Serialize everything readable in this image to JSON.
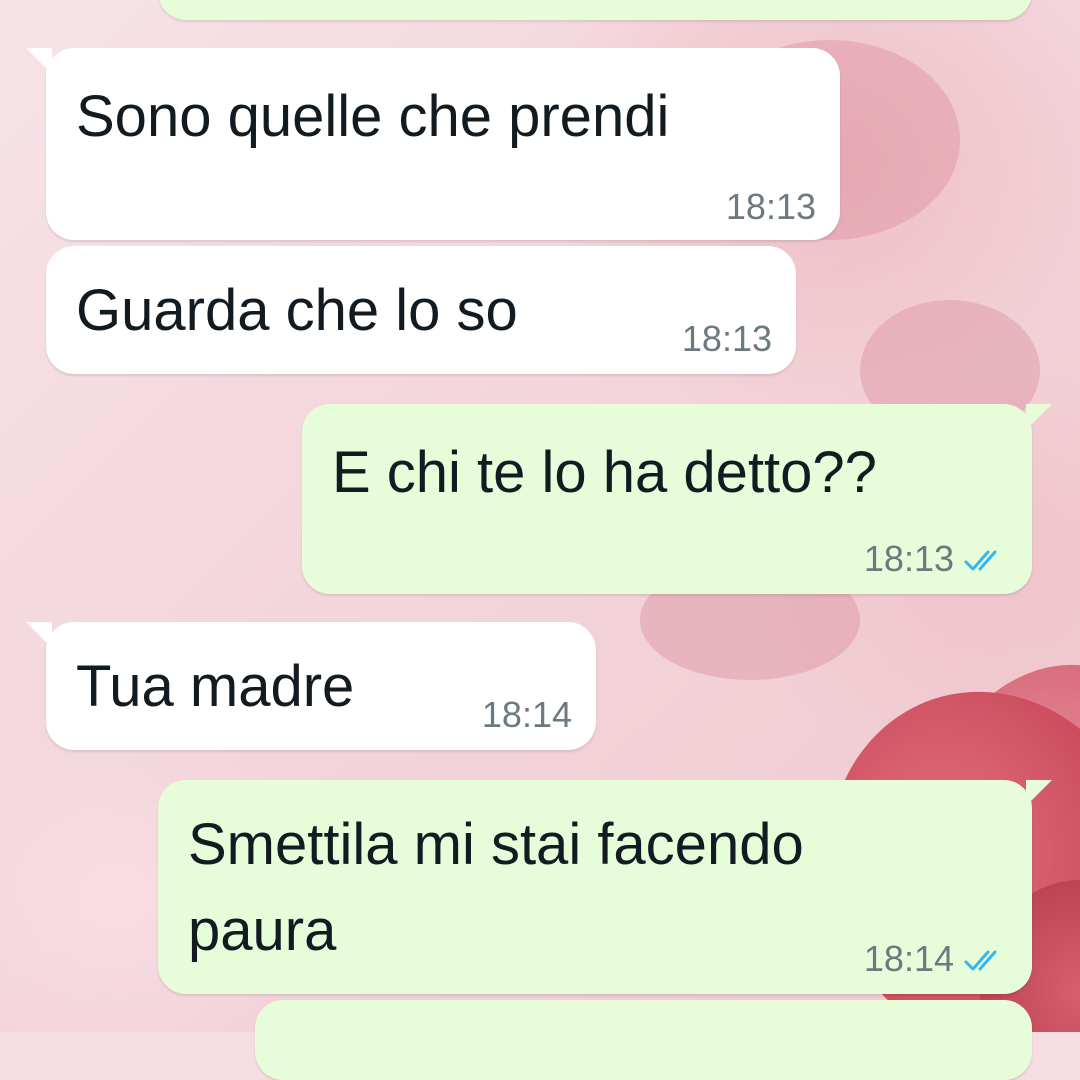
{
  "colors": {
    "incoming_bubble": "#ffffff",
    "outgoing_bubble": "#e7fcd9",
    "read_ticks": "#34b7f1",
    "timestamp": "#6b7a80"
  },
  "messages": [
    {
      "direction": "outgoing",
      "text": "",
      "time": ""
    },
    {
      "direction": "incoming",
      "text": "Sono quelle che prendi",
      "time": "18:13"
    },
    {
      "direction": "incoming",
      "text": "Guarda che lo so",
      "time": "18:13"
    },
    {
      "direction": "outgoing",
      "text": "E chi te lo ha detto??",
      "time": "18:13",
      "status_icon": "double-check-read-icon"
    },
    {
      "direction": "incoming",
      "text": "Tua madre",
      "time": "18:14"
    },
    {
      "direction": "outgoing",
      "text_lines": [
        "Smettila mi stai facendo",
        "paura"
      ],
      "time": "18:14",
      "status_icon": "double-check-read-icon"
    },
    {
      "direction": "outgoing",
      "text": "",
      "time": ""
    }
  ]
}
